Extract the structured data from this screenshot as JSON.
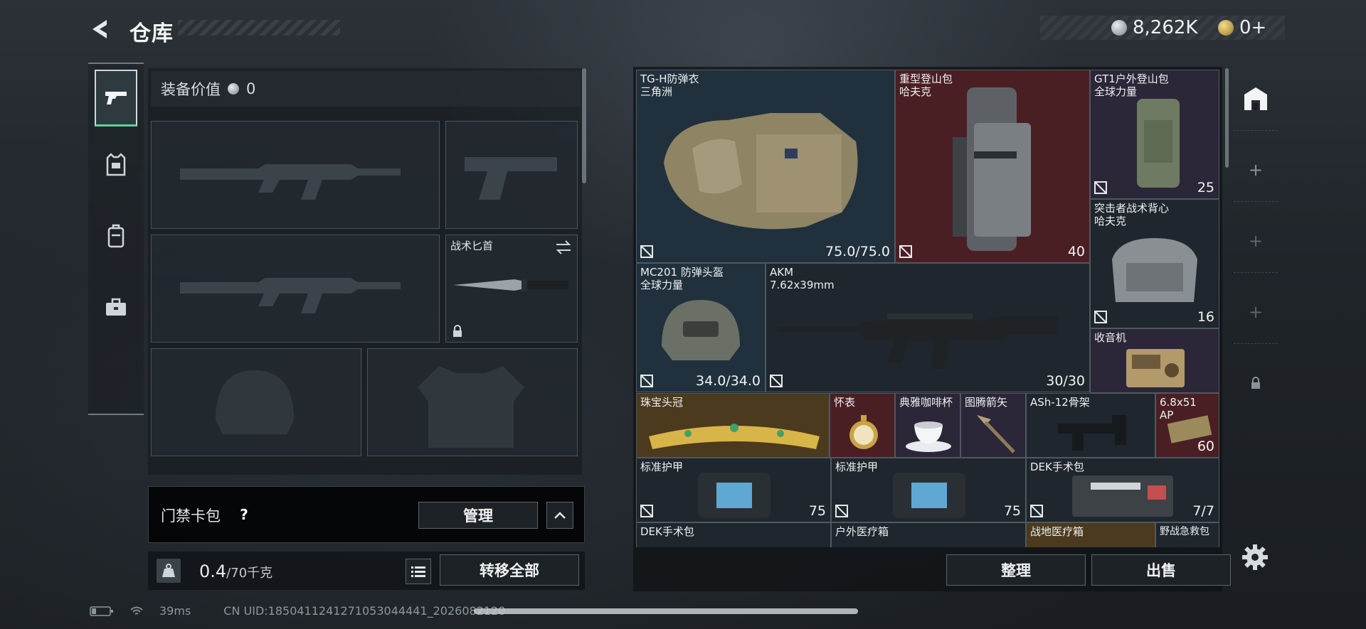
{
  "header": {
    "title": "仓库",
    "currency": [
      {
        "icon": "silver-coin-icon",
        "value": "8,262K"
      },
      {
        "icon": "gold-coin-icon",
        "value": "0+"
      }
    ]
  },
  "equipment": {
    "value_label": "装备价值",
    "value": "0",
    "knife_label": "战术匕首"
  },
  "keycard": {
    "label": "门禁卡包",
    "help": "?",
    "manage_label": "管理"
  },
  "weight": {
    "current": "0.4",
    "max": "/70千克",
    "transfer_label": "转移全部"
  },
  "items": [
    {
      "name": "TG-H防弹衣\n三角洲",
      "value": "75.0/75.0"
    },
    {
      "name": "重型登山包\n哈夫克",
      "value": "40"
    },
    {
      "name": "GT1户外登山包\n全球力量",
      "value": "25"
    },
    {
      "name": "突击者战术背心\n哈夫克",
      "value": "16"
    },
    {
      "name": "MC201 防弹头盔\n全球力量",
      "value": "34.0/34.0"
    },
    {
      "name": "AKM\n7.62x39mm",
      "value": "30/30"
    },
    {
      "name": "收音机",
      "value": ""
    },
    {
      "name": "珠宝头冠",
      "value": ""
    },
    {
      "name": "怀表",
      "value": ""
    },
    {
      "name": "典雅咖啡杯",
      "value": ""
    },
    {
      "name": "图腾箭矢",
      "value": ""
    },
    {
      "name": "ASh-12骨架",
      "value": ""
    },
    {
      "name": "6.8x51\nAP",
      "value": "60"
    },
    {
      "name": "标准护甲",
      "value": "75"
    },
    {
      "name": "标准护甲",
      "value": "75"
    },
    {
      "name": "DEK手术包",
      "value": "7/7"
    },
    {
      "name": "DEK手术包",
      "value": ""
    },
    {
      "name": "户外医疗箱",
      "value": ""
    },
    {
      "name": "战地医疗箱",
      "value": ""
    },
    {
      "name": "野战急救包",
      "value": ""
    }
  ],
  "actions": {
    "sort_label": "整理",
    "sell_label": "出售"
  },
  "footer": {
    "ping": "39ms",
    "uid": "CN UID:1850411241271053044441_2026082120"
  },
  "colors": {
    "accent_green": "#59d49a",
    "grid_blue": "#20313d",
    "grid_red": "#4a1f24",
    "grid_purple": "#2b2638",
    "grid_gold": "#4b3a1e"
  }
}
